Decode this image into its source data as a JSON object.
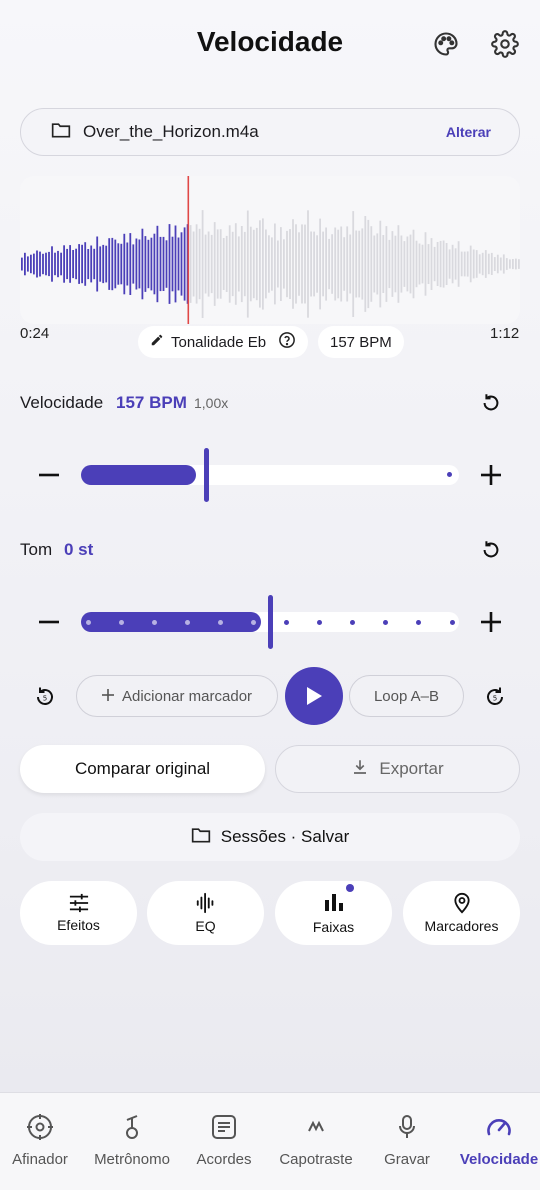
{
  "header": {
    "title": "Velocidade"
  },
  "file": {
    "name": "Over_the_Horizon.m4a",
    "change_label": "Alterar"
  },
  "waveform": {
    "progress": 0.335,
    "current_time": "0:24",
    "duration": "1:12"
  },
  "info_chips": {
    "key_label": "Tonalidade Eb",
    "bpm_label": "157 BPM"
  },
  "speed": {
    "label": "Velocidade",
    "value": "157 BPM",
    "ratio": "1,00x",
    "fraction": 0.33
  },
  "pitch": {
    "label": "Tom",
    "value": "0 st",
    "fraction": 0.5
  },
  "transport": {
    "add_marker": "Adicionar marcador",
    "loop": "Loop A–B"
  },
  "actions": {
    "compare": "Comparar original",
    "export": "Exportar"
  },
  "sessions": {
    "label": "Sessões · Salvar"
  },
  "tools": [
    {
      "label": "Efeitos"
    },
    {
      "label": "EQ"
    },
    {
      "label": "Faixas"
    },
    {
      "label": "Marcadores"
    }
  ],
  "nav": [
    {
      "label": "Afinador"
    },
    {
      "label": "Metrônomo"
    },
    {
      "label": "Acordes"
    },
    {
      "label": "Capotraste"
    },
    {
      "label": "Gravar"
    },
    {
      "label": "Velocidade"
    }
  ],
  "colors": {
    "accent": "#4b3fb8",
    "waveform_inactive": "#d9d9de",
    "playhead": "#e04848"
  }
}
